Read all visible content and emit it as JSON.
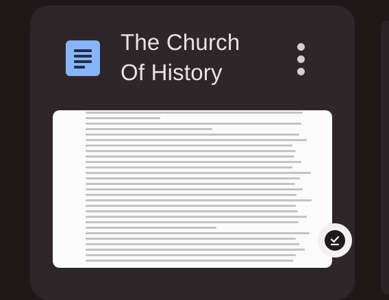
{
  "card": {
    "title_line1": "The Church",
    "title_line2": "Of History",
    "doc_icon": "google-docs-icon",
    "more_icon": "more-vert-icon",
    "offline_badge_icon": "offline-check-icon"
  },
  "colors": {
    "background": "#1f1718",
    "card": "#2e2628",
    "docs_blue": "#8ab4f8",
    "title_text": "#e9e3e4"
  }
}
